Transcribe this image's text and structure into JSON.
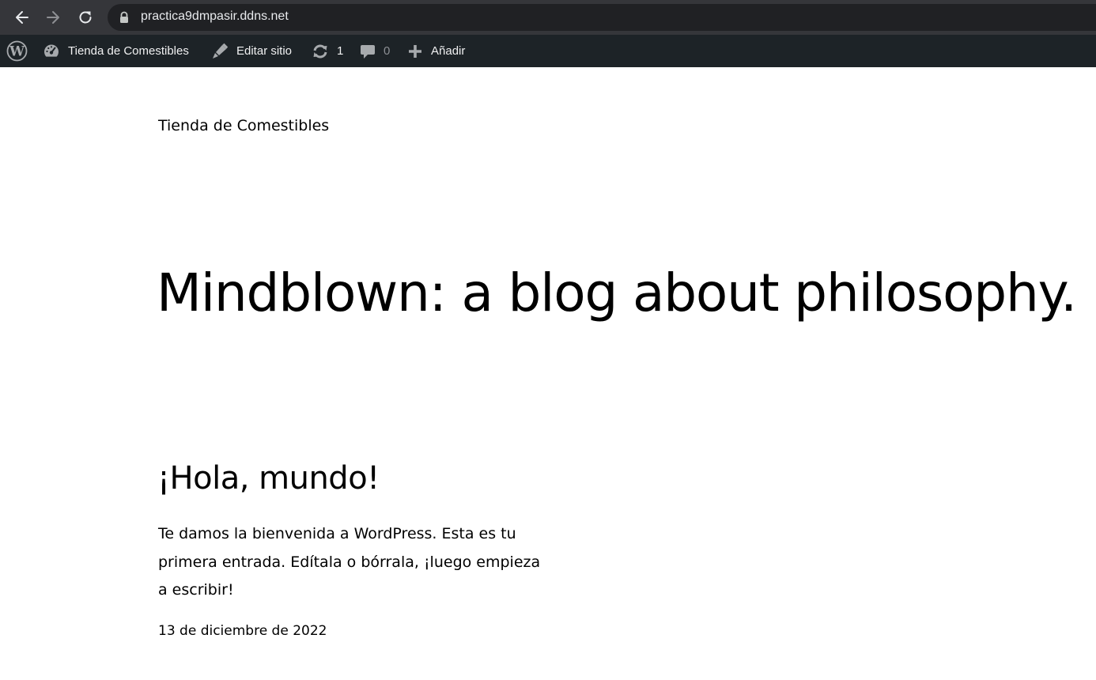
{
  "browser": {
    "url": "practica9dmpasir.ddns.net",
    "icons": {
      "back": "back-arrow-icon",
      "forward": "forward-arrow-icon",
      "reload": "reload-icon",
      "lock": "lock-icon"
    }
  },
  "admin_bar": {
    "wp_logo": "wordpress-logo-icon",
    "site_name": "Tienda de Comestibles",
    "edit_site": "Editar sitio",
    "updates_count": "1",
    "comments_count": "0",
    "add_new": "Añadir"
  },
  "site": {
    "title": "Tienda de Comestibles",
    "tagline_heading": "Mindblown: a blog about philosophy."
  },
  "post": {
    "title": "¡Hola, mundo!",
    "excerpt": "Te damos la bienvenida a WordPress. Esta es tu primera entrada. Edítala o bórrala, ¡luego empieza a escribir!",
    "date": "13 de diciembre de 2022"
  },
  "colors": {
    "browser_bar": "#35363a",
    "omnibox": "#202124",
    "admin_bar": "#1d2327",
    "admin_text": "#f0f0f1",
    "dim_text": "#8c8f94"
  }
}
